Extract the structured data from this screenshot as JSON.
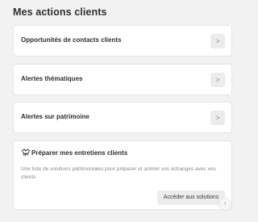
{
  "section": {
    "title": "Mes actions clients"
  },
  "rows": [
    {
      "label": "Opportunités de contacts clients"
    },
    {
      "label": "Alertes thématiques"
    },
    {
      "label": "Alertes sur patrimoine"
    }
  ],
  "icons": {
    "chevron": "chevron-right-icon",
    "handshake": "handshake-icon",
    "scroll_top": "arrow-up-icon"
  },
  "prepare_card": {
    "title": "Préparer mes entretiens clients",
    "description": "Une liste de solutions patrimoniales pour préparer et animer vos échanges avec vos clients",
    "cta_label": "Accéder aux solutions"
  },
  "colors": {
    "background": "#f2f2f2",
    "card": "#ffffff",
    "button": "#ececec"
  }
}
